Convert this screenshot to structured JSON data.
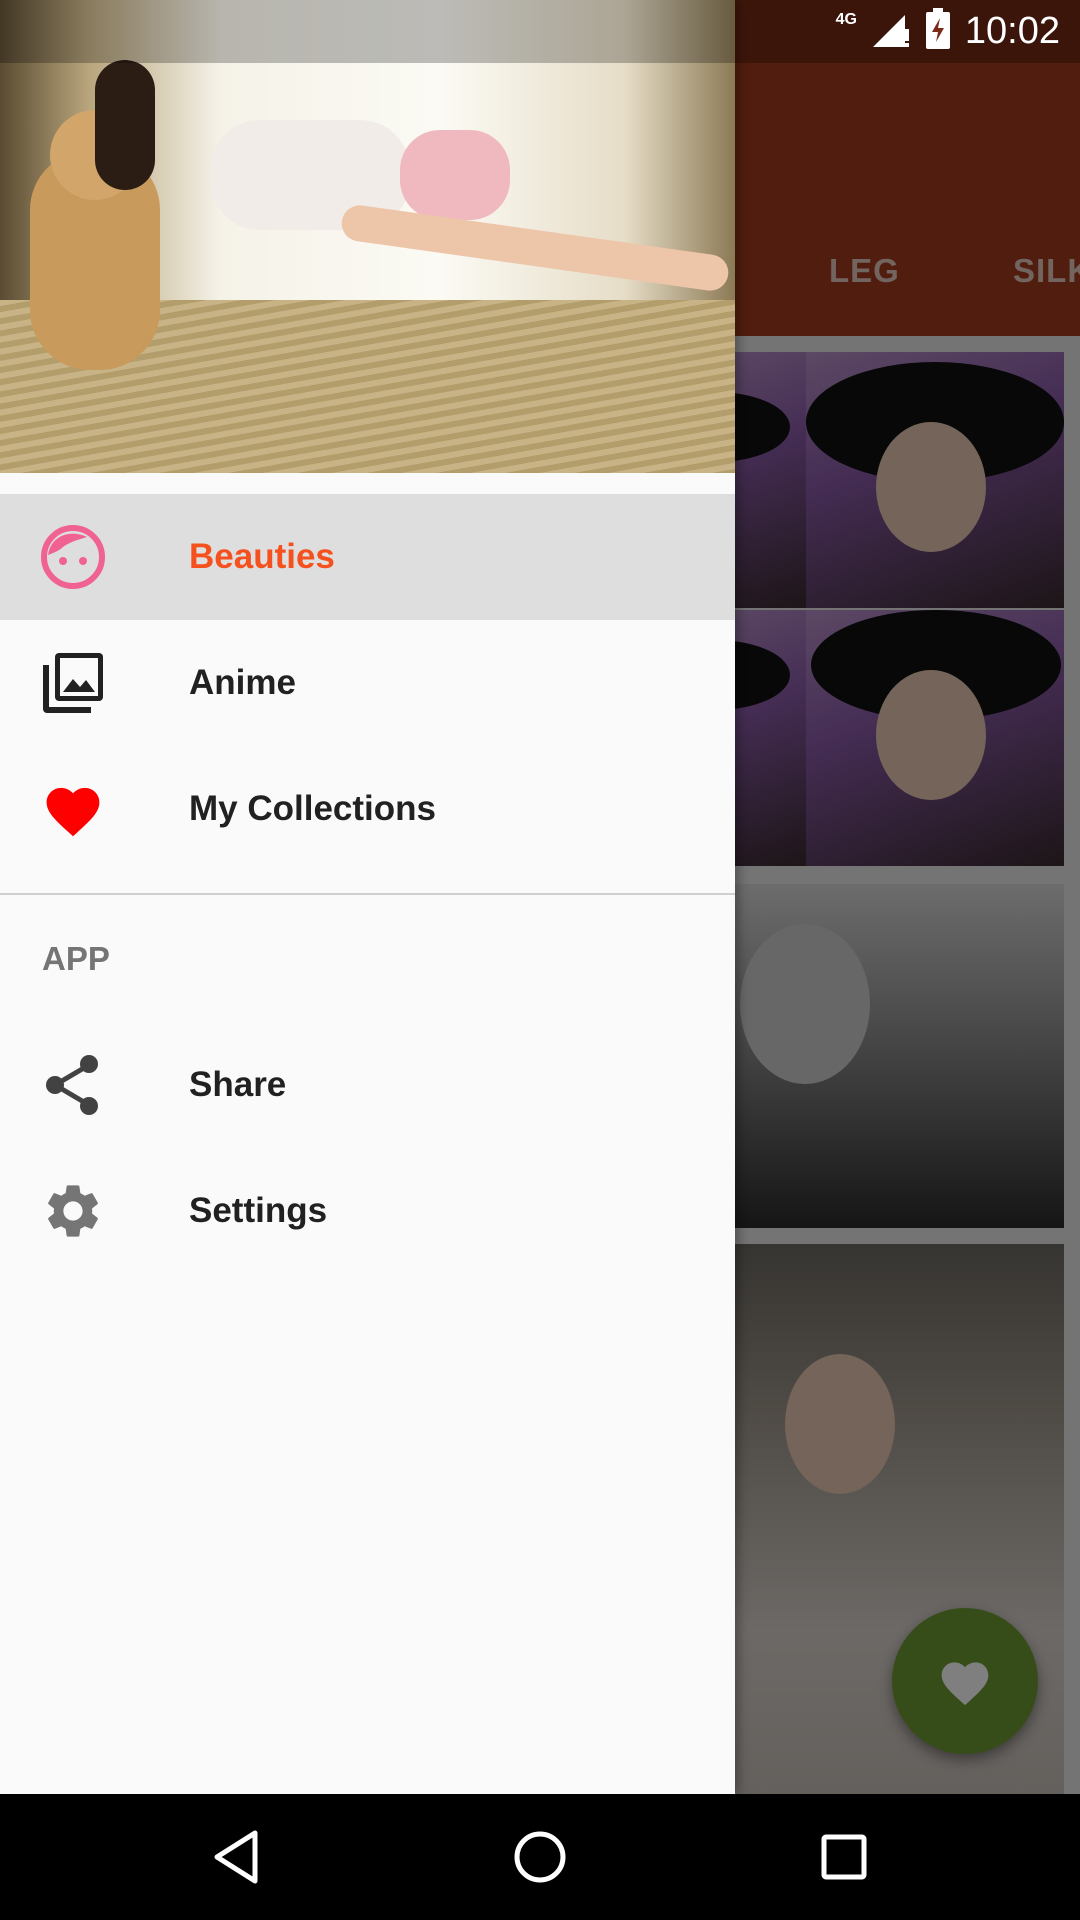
{
  "status_bar": {
    "network": "4G",
    "time": "10:02"
  },
  "background_app": {
    "tabs": [
      "LEG",
      "SILK"
    ],
    "toolbar_color": "#a23a1c",
    "fab_icon": "heart-icon",
    "fab_color": "#6c9a32"
  },
  "drawer": {
    "main_items": [
      {
        "label": "Beauties",
        "icon": "face-icon",
        "selected": true
      },
      {
        "label": "Anime",
        "icon": "photo-library-icon",
        "selected": false
      },
      {
        "label": "My Collections",
        "icon": "heart-icon",
        "selected": false
      }
    ],
    "section_title": "APP",
    "app_items": [
      {
        "label": "Share",
        "icon": "share-icon"
      },
      {
        "label": "Settings",
        "icon": "gear-icon"
      }
    ],
    "accent_color": "#f4511e"
  },
  "nav_bar": {
    "buttons": [
      "back-icon",
      "home-icon",
      "recents-icon"
    ]
  }
}
